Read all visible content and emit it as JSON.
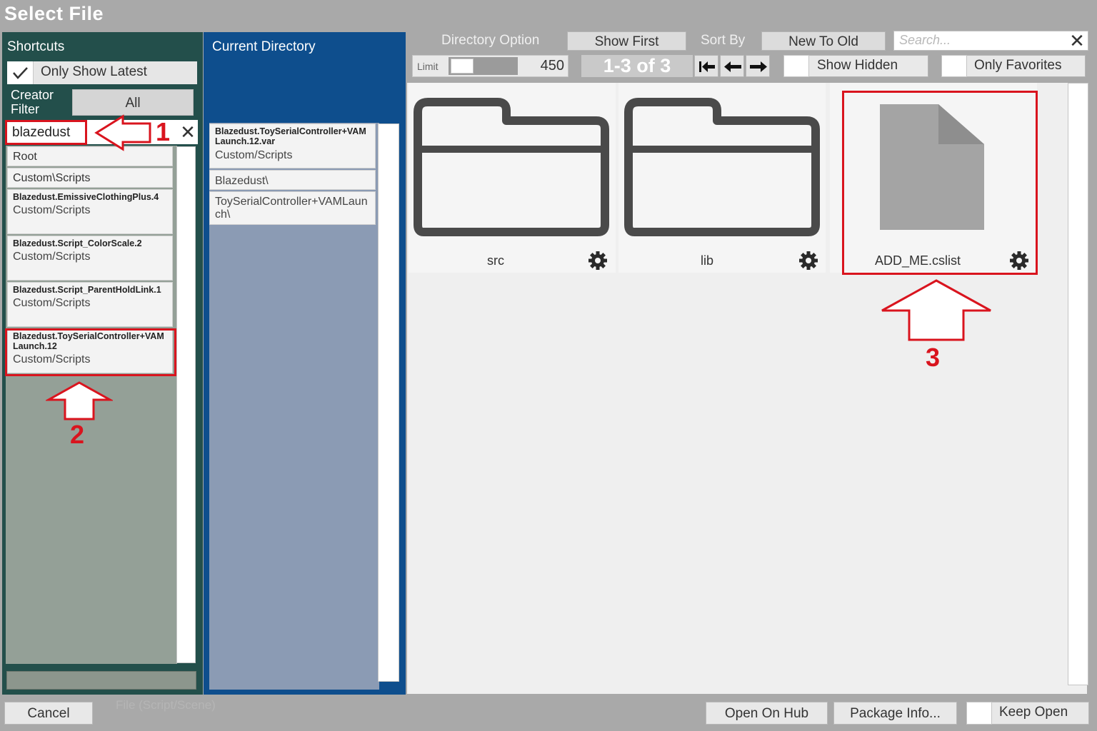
{
  "window": {
    "title": "Select File"
  },
  "shortcuts": {
    "header": "Shortcuts",
    "only_show_latest": "Only Show Latest",
    "creator_filter_label": "Creator Filter",
    "creator_filter_value": "All",
    "filter_text": "blazedust",
    "items": [
      {
        "label": "Root"
      },
      {
        "label": "Custom\\Scripts"
      },
      {
        "package": "Blazedust.EmissiveClothingPlus.4",
        "path": "Custom/Scripts"
      },
      {
        "package": "Blazedust.Script_ColorScale.2",
        "path": "Custom/Scripts"
      },
      {
        "package": "Blazedust.Script_ParentHoldLink.1",
        "path": "Custom/Scripts"
      },
      {
        "package": "Blazedust.ToySerialController+VAMLaunch.12",
        "path": "Custom/Scripts"
      }
    ]
  },
  "current_directory": {
    "header": "Current Directory",
    "items": [
      {
        "package": "Blazedust.ToySerialController+VAMLaunch.12.var",
        "path": "Custom/Scripts"
      },
      {
        "label": "Blazedust\\"
      },
      {
        "label": "ToySerialController+VAMLaunch\\"
      }
    ]
  },
  "toolbar": {
    "directory_option": "Directory Option",
    "show_first": "Show First",
    "sort_by": "Sort By",
    "sort_value": "New To Old",
    "search_placeholder": "Search...",
    "limit_label": "Limit",
    "limit_value": "450",
    "page_info": "1-3 of 3",
    "show_hidden": "Show Hidden",
    "only_favorites": "Only Favorites"
  },
  "files": [
    {
      "name": "src",
      "type": "folder"
    },
    {
      "name": "lib",
      "type": "folder"
    },
    {
      "name": "ADD_ME.cslist",
      "type": "file"
    }
  ],
  "bottom": {
    "cancel": "Cancel",
    "faint_label": "File (Script/Scene)",
    "open_on_hub": "Open On Hub",
    "package_info": "Package Info...",
    "keep_open": "Keep Open"
  },
  "annotations": {
    "step1": "1",
    "step2": "2",
    "step3": "3",
    "color": "#d9141e"
  },
  "colors": {
    "shortcuts_panel": "#234f4b",
    "current_dir_panel": "#0e4e8d",
    "window_bg": "#a9a9a9"
  }
}
